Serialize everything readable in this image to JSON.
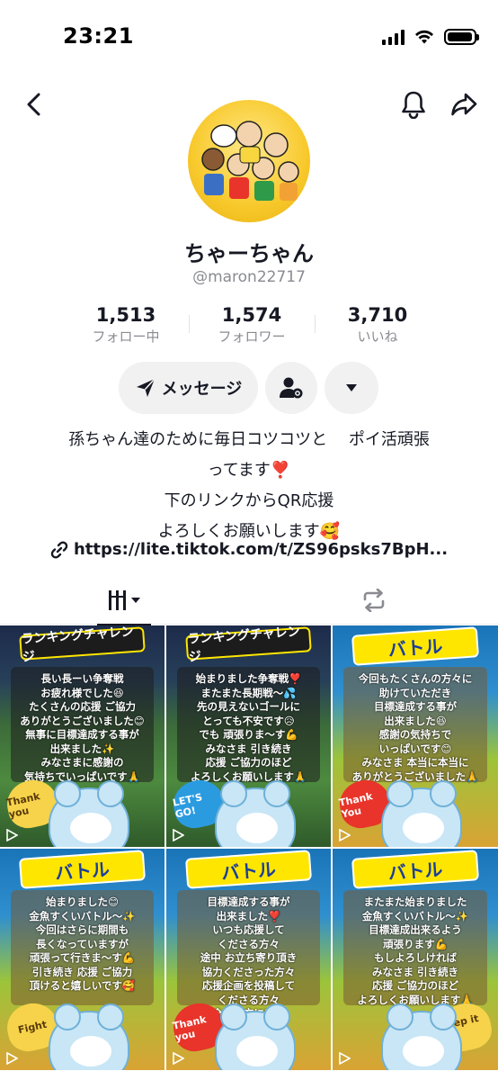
{
  "status_bar": {
    "time": "23:21",
    "battery_level": 0.95
  },
  "profile": {
    "display_name": "ちゃーちゃん",
    "handle": "@maron22717"
  },
  "stats": [
    {
      "value": "1,513",
      "label": "フォロー中"
    },
    {
      "value": "1,574",
      "label": "フォロワー"
    },
    {
      "value": "3,710",
      "label": "いいね"
    }
  ],
  "actions": {
    "message_label": "メッセージ"
  },
  "bio": {
    "lines": [
      "孫ちゃん達のために毎日コツコツと　 ポイ活頑張",
      "ってます❣️",
      "下のリンクからQR応援",
      "よろしくお願いします🥰"
    ],
    "link": "https://lite.tiktok.com/t/ZS96psks7BpH..."
  },
  "tabs": {
    "active": "videos"
  },
  "videos": [
    {
      "banner": "ランキングチャレンジ",
      "caption": "長い長ーい争奪戦\nお疲れ様でした😆\nたくさんの応援 ご協力\nありがとうございました😊\n無事に目標達成する事が\n出来ました✨\nみなさまに感謝の\n気持ちでいっぱいです🙏",
      "sticker": "Thank you"
    },
    {
      "banner": "ランキングチャレンジ",
      "caption": "始まりました争奪戦❣️\nまたまた長期戦〜💦\n先の見えないゴールに\nとっても不安です😥\nでも 頑張りま〜す💪\nみなさま 引き続き\n応援 ご協力のほど\nよろしくお願いします🙏",
      "sticker": "LET'S GO!"
    },
    {
      "banner": "バトル",
      "caption": "今回もたくさんの方々に\n助けていただき\n目標達成する事が\n出来ました😆\n感謝の気持ちで\nいっぱいです😊\nみなさま 本当に本当に\nありがとうございました🙏",
      "sticker": "Thank You"
    },
    {
      "banner": "バトル",
      "caption": "始まりました😊\n金魚すくいバトル〜✨\n今回はさらに期間も\n長くなっていますが\n頑張って行きま〜す💪\n引き続き 応援 ご協力\n頂けると嬉しいです🥰",
      "sticker": "Fight"
    },
    {
      "banner": "バトル",
      "caption": "目標達成する事が\n出来ました❣️\nいつも応援して\nくださる方々\n途中 お立ち寄り頂き\n協力くださった方々\n応援企画を投稿して\nくださる方々\n全ての方に感謝\n申し上げます🙏",
      "sticker": "Thank you"
    },
    {
      "banner": "バトル",
      "caption": "またまた始まりました\n金魚すくいバトル〜✨\n目標達成出来るよう\n頑張ります💪\nもしよろしければ\nみなさま 引き続き\n応援 ご協力のほど\nよろしくお願いします🙏",
      "sticker": "Keep it up"
    }
  ]
}
